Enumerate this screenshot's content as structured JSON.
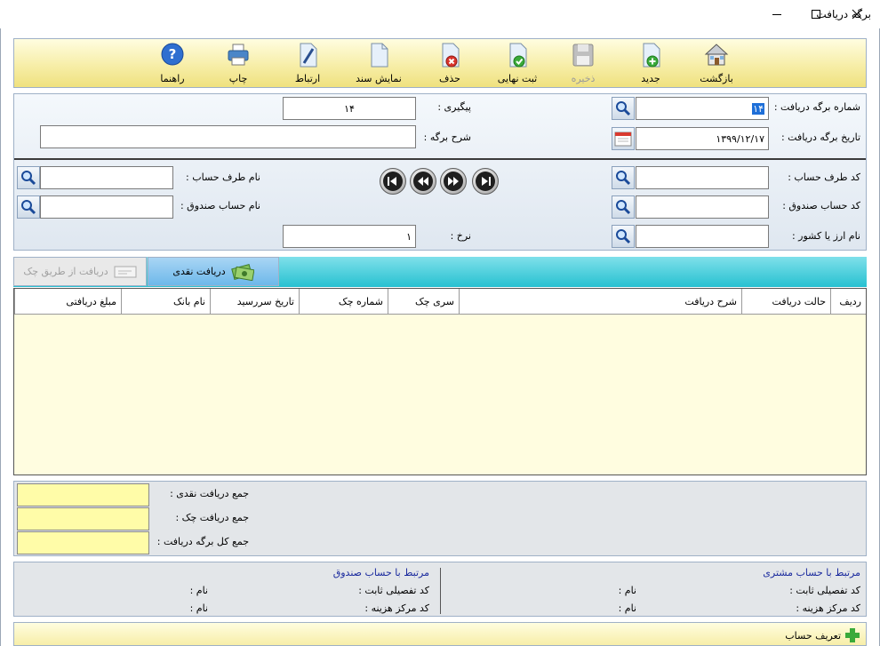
{
  "window": {
    "title": "برگه دریافت"
  },
  "toolbar": {
    "back": "بازگشت",
    "new": "جدید",
    "save": "ذخیره",
    "finalize": "ثبت نهایی",
    "delete": "حذف",
    "show_doc": "نمایش سند",
    "link": "ارتباط",
    "print": "چاپ",
    "help": "راهنما"
  },
  "header": {
    "receipt_no_label": "شماره برگه دریافت :",
    "receipt_no_value": "۱۴",
    "receipt_date_label": "تاریخ برگه دریافت :",
    "receipt_date_value": "۱۳۹۹/۱۲/۱۷",
    "tracking_label": "پیگیری :",
    "tracking_value": "۱۴",
    "description_label": "شرح برگه :",
    "description_value": "",
    "party_code_label": "کد طرف حساب :",
    "party_code_value": "",
    "cashbox_code_label": "کد حساب صندوق :",
    "cashbox_code_value": "",
    "currency_label": "نام ارز یا کشور :",
    "currency_value": "",
    "party_name_label": "نام طرف حساب :",
    "party_name_value": "",
    "cashbox_name_label": "نام حساب صندوق :",
    "cashbox_name_value": "",
    "rate_label": "نرخ :",
    "rate_value": "۱"
  },
  "tabs": {
    "cheque": "دریافت از طریق چک",
    "cash": "دریافت نقدی"
  },
  "grid": {
    "columns": [
      "ردیف",
      "حالت دریافت",
      "شرح دریافت",
      "سری چک",
      "شماره چک",
      "تاریخ سررسید",
      "نام بانک",
      "مبلغ دریافتی"
    ]
  },
  "totals": {
    "cash_label": "جمع دریافت نقدی :",
    "cheque_label": "جمع دریافت چک :",
    "total_label": "جمع کل برگه دریافت :",
    "cash_value": "",
    "cheque_value": "",
    "total_value": ""
  },
  "links": {
    "customer_title": "مرتبط با حساب مشتری",
    "cashbox_title": "مرتبط با حساب صندوق",
    "fixed_detail_label": "کد تفصیلی ثابت :",
    "cost_center_label": "کد مرکز هزینه :",
    "name_label": "نام :"
  },
  "bottom": {
    "define_account": "تعریف حساب"
  }
}
